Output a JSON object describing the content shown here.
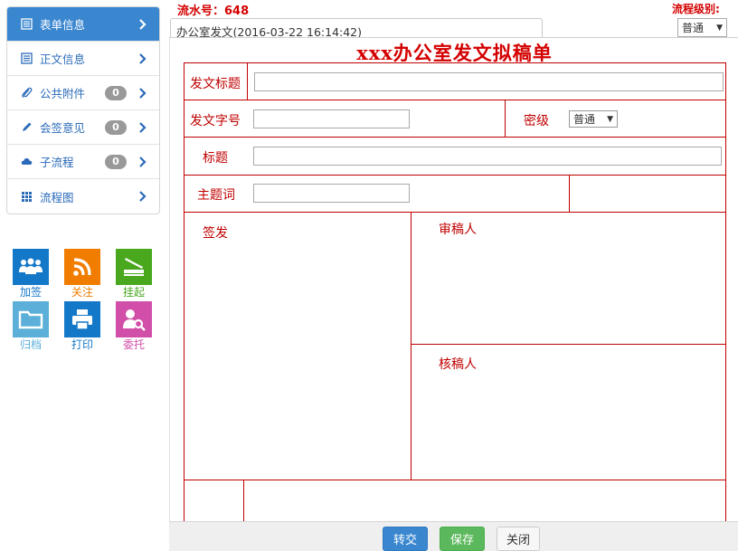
{
  "sidebar": {
    "items": [
      {
        "label": "表单信息",
        "icon": "list-icon",
        "badge": ""
      },
      {
        "label": "正文信息",
        "icon": "list-icon",
        "badge": ""
      },
      {
        "label": "公共附件",
        "icon": "paperclip-icon",
        "badge": "0"
      },
      {
        "label": "会签意见",
        "icon": "pencil-icon",
        "badge": "0"
      },
      {
        "label": "子流程",
        "icon": "cloud-icon",
        "badge": "0"
      },
      {
        "label": "流程图",
        "icon": "grid-icon",
        "badge": ""
      }
    ]
  },
  "tools": [
    {
      "label": "加签",
      "icon": "users-icon",
      "color": "#1478c8"
    },
    {
      "label": "关注",
      "icon": "rss-icon",
      "color": "#f07d00"
    },
    {
      "label": "挂起",
      "icon": "scanner-icon",
      "color": "#4aa81e"
    },
    {
      "label": "归档",
      "icon": "folder-icon",
      "color": "#5bafd8"
    },
    {
      "label": "打印",
      "icon": "printer-icon",
      "color": "#1478c8"
    },
    {
      "label": "委托",
      "icon": "user-search-icon",
      "color": "#d14fa8"
    }
  ],
  "header": {
    "serial": "流水号：648",
    "level_label": "流程级别:",
    "level_value": "普通",
    "tab": "办公室发文(2016-03-22 16:14:42)"
  },
  "form": {
    "title": "xxx办公室发文拟稿单",
    "labels": {
      "doc_title": "发文标题",
      "doc_number": "发文字号",
      "secrecy": "密级",
      "subject": "标题",
      "keywords": "主题词",
      "sign": "签发",
      "reviewer": "审稿人",
      "checker": "核稿人"
    },
    "values": {
      "doc_title": "",
      "doc_number": "",
      "secrecy": "普通",
      "subject": "",
      "keywords": ""
    }
  },
  "footer": {
    "submit": "转交",
    "save": "保存",
    "close": "关闭"
  },
  "colors": {
    "accent": "#3a87d0",
    "form_red": "#c00000",
    "submit_blue": "#3a87d0",
    "save_green": "#5cb85c"
  }
}
